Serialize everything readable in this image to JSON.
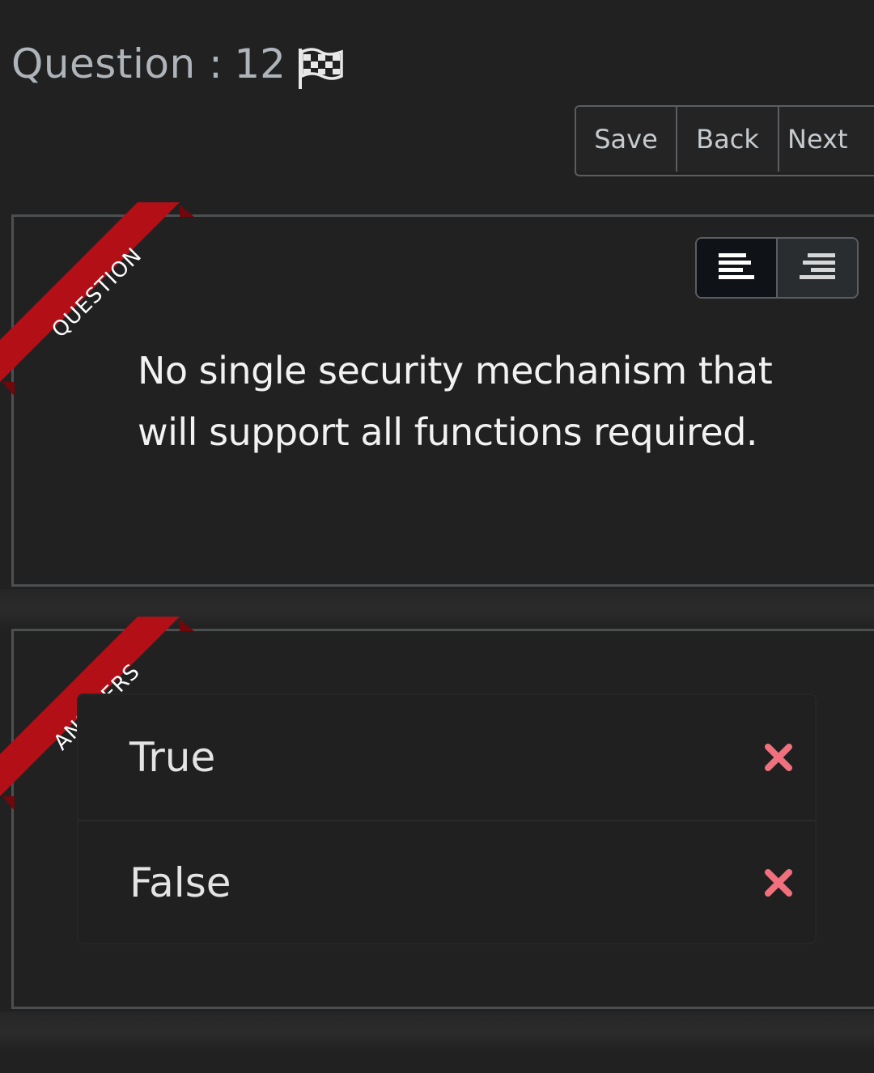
{
  "header": {
    "question_label": "Question :",
    "question_number": "12",
    "flag_icon": "checkered-flag-icon"
  },
  "nav": {
    "save_label": "Save",
    "back_label": "Back",
    "next_label": "Next"
  },
  "question_panel": {
    "ribbon_label": "QUESTION",
    "text": "No single security mechanism that will support all functions required.",
    "layout_toggle": {
      "options": [
        "align-left-icon",
        "align-right-icon"
      ],
      "active": "align-left-icon"
    }
  },
  "answers_panel": {
    "ribbon_label": "ANSWERS",
    "answers": [
      {
        "label": "True",
        "status_icon": "cross-icon"
      },
      {
        "label": "False",
        "status_icon": "cross-icon"
      }
    ]
  },
  "colors": {
    "background": "#212121",
    "ribbon": "#b00e16",
    "cross": "#f0707e"
  }
}
